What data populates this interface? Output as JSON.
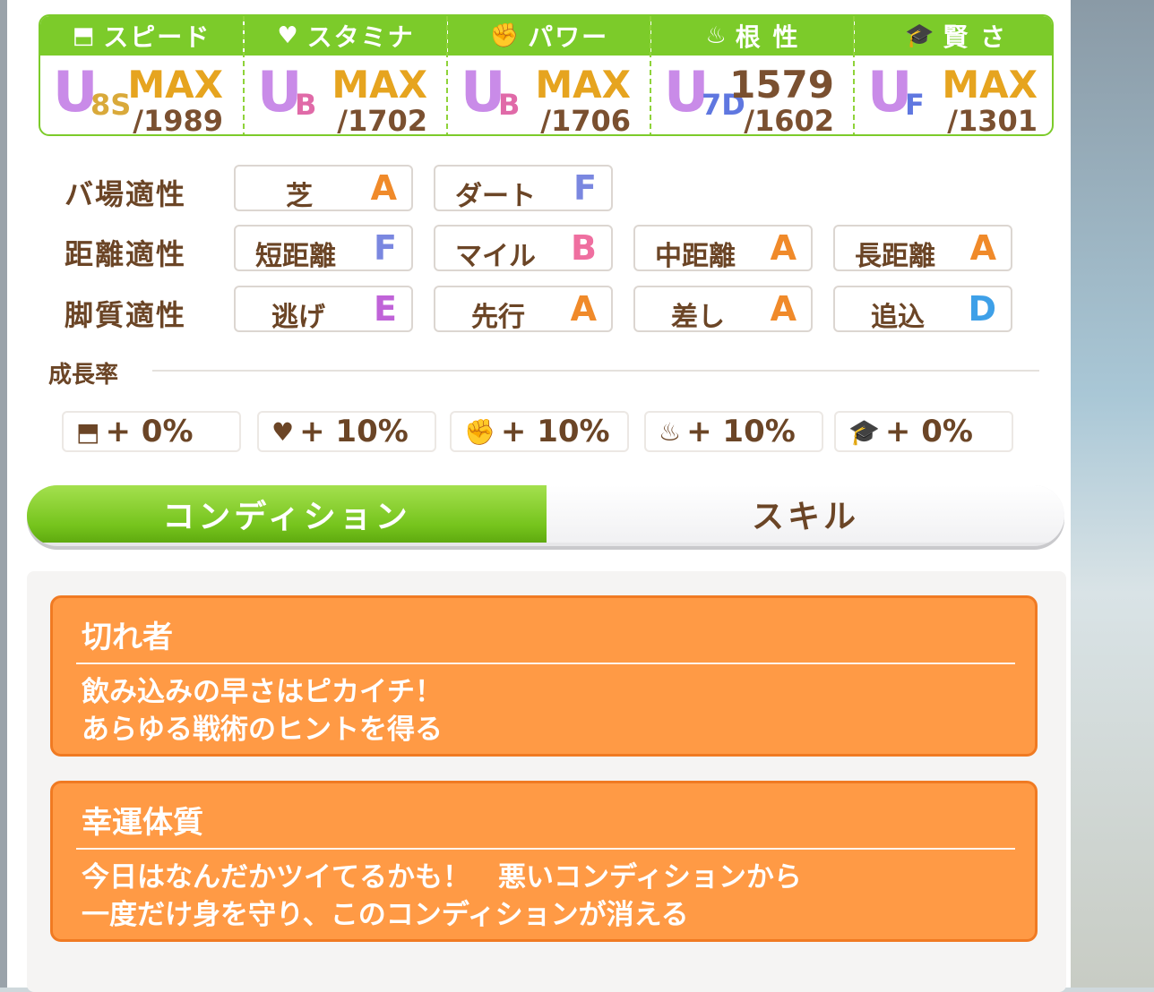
{
  "stats": [
    {
      "name": "スピード",
      "icon": "⬒",
      "rank": "U",
      "rank_sub": "8S",
      "value": "MAX",
      "max": "/1989"
    },
    {
      "name": "スタミナ",
      "icon": "♥",
      "rank": "U",
      "rank_sub": "B",
      "value": "MAX",
      "max": "/1702"
    },
    {
      "name": "パワー",
      "icon": "✊",
      "rank": "U",
      "rank_sub": "B",
      "value": "MAX",
      "max": "/1706"
    },
    {
      "name": "根 性",
      "icon": "♨",
      "rank": "U",
      "rank_sub": "7D",
      "value": "1579",
      "max": "/1602"
    },
    {
      "name": "賢 さ",
      "icon": "🎓",
      "rank": "U",
      "rank_sub": "F",
      "value": "MAX",
      "max": "/1301"
    }
  ],
  "aptitude": {
    "track": {
      "label": "バ場適性",
      "items": [
        {
          "name": "芝",
          "grade": "A"
        },
        {
          "name": "ダート",
          "grade": "F"
        }
      ]
    },
    "distance": {
      "label": "距離適性",
      "items": [
        {
          "name": "短距離",
          "grade": "F"
        },
        {
          "name": "マイル",
          "grade": "B"
        },
        {
          "name": "中距離",
          "grade": "A"
        },
        {
          "name": "長距離",
          "grade": "A"
        }
      ]
    },
    "style": {
      "label": "脚質適性",
      "items": [
        {
          "name": "逃げ",
          "grade": "E"
        },
        {
          "name": "先行",
          "grade": "A"
        },
        {
          "name": "差し",
          "grade": "A"
        },
        {
          "name": "追込",
          "grade": "D"
        }
      ]
    }
  },
  "growth": {
    "title": "成長率",
    "items": [
      {
        "icon": "⬒",
        "value": "+ 0%"
      },
      {
        "icon": "♥",
        "value": "+ 10%"
      },
      {
        "icon": "✊",
        "value": "+ 10%"
      },
      {
        "icon": "♨",
        "value": "+ 10%"
      },
      {
        "icon": "🎓",
        "value": "+ 0%"
      }
    ]
  },
  "tabs": {
    "condition": "コンディション",
    "skill": "スキル"
  },
  "conditions": [
    {
      "title": "切れ者",
      "desc": "飲み込みの早さはピカイチ！\nあらゆる戦術のヒントを得る"
    },
    {
      "title": "幸運体質",
      "desc": "今日はなんだかツイてるかも！　悪いコンディションから\n一度だけ身を守り、このコンディションが消える"
    }
  ]
}
